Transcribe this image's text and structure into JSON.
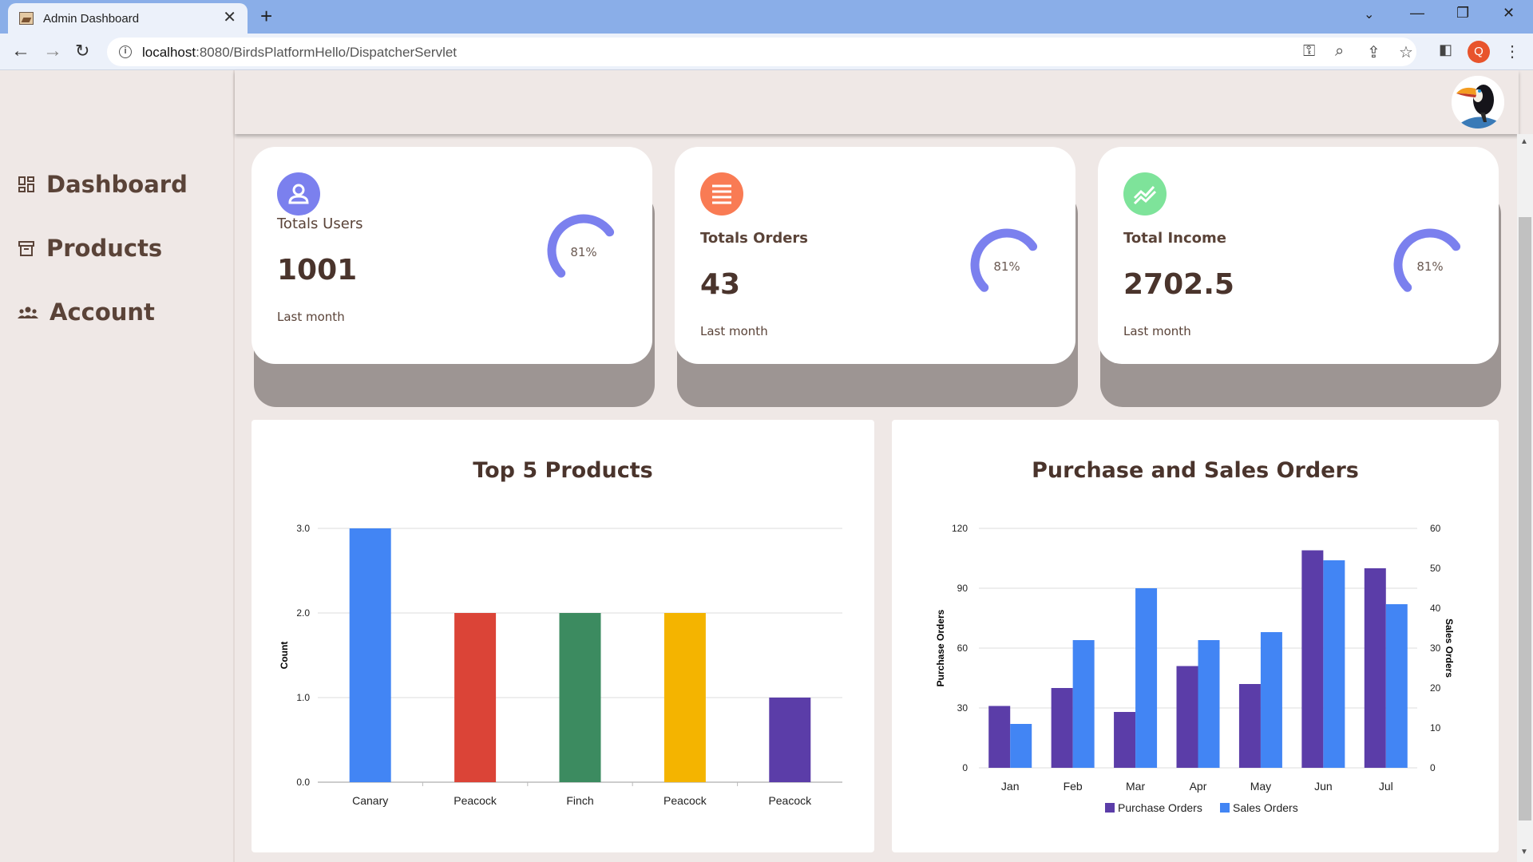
{
  "browser": {
    "tab_title": "Admin Dashboard",
    "url_host": "localhost",
    "url_rest": ":8080/BirdsPlatformHello/DispatcherServlet",
    "profile_initial": "Q"
  },
  "sidebar": {
    "items": [
      {
        "label": "Dashboard",
        "icon": "dashboard-icon"
      },
      {
        "label": "Products",
        "icon": "archive-box-icon"
      },
      {
        "label": "Account",
        "icon": "people-icon"
      }
    ]
  },
  "cards": [
    {
      "label": "Totals Users",
      "value": "1001",
      "period": "Last month",
      "percent": "81%",
      "percent_value": 0.81,
      "icon": "user-icon",
      "icon_color": "#7b80ee"
    },
    {
      "label": "Totals Orders",
      "value": "43",
      "period": "Last month",
      "percent": "81%",
      "percent_value": 0.81,
      "icon": "list-icon",
      "icon_color": "#f97b54"
    },
    {
      "label": "Total Income",
      "value": "2702.5",
      "period": "Last month",
      "percent": "81%",
      "percent_value": 0.81,
      "icon": "trend-chart-icon",
      "icon_color": "#7ee39a"
    }
  ],
  "chart_data": [
    {
      "type": "bar",
      "title": "Top 5 Products",
      "categories": [
        "Canary",
        "Peacock",
        "Finch",
        "Peacock",
        "Peacock"
      ],
      "values": [
        3,
        2,
        2,
        2,
        1
      ],
      "colors": [
        "#4285f4",
        "#db4437",
        "#3c8b60",
        "#f4b400",
        "#5b3da8"
      ],
      "ylabel": "Count",
      "ylim": [
        0,
        3
      ],
      "yticks": [
        "0.0",
        "1.0",
        "2.0",
        "3.0"
      ],
      "grid": true
    },
    {
      "type": "bar",
      "title": "Purchase and Sales Orders",
      "categories": [
        "Jan",
        "Feb",
        "Mar",
        "Apr",
        "May",
        "Jun",
        "Jul"
      ],
      "series": [
        {
          "name": "Purchase Orders",
          "values": [
            31,
            40,
            28,
            51,
            42,
            109,
            100
          ],
          "axis": "left",
          "color": "#5b3da8"
        },
        {
          "name": "Sales Orders",
          "values": [
            11,
            32,
            45,
            32,
            34,
            52,
            41
          ],
          "axis": "right",
          "color": "#4285f4"
        }
      ],
      "ylabel_left": "Purchase Orders",
      "ylabel_right": "Sales Orders",
      "ylim_left": [
        0,
        120
      ],
      "ylim_right": [
        0,
        60
      ],
      "yticks_left": [
        "0",
        "30",
        "60",
        "90",
        "120"
      ],
      "yticks_right": [
        "0",
        "10",
        "20",
        "30",
        "40",
        "50",
        "60"
      ],
      "legend": "bottom",
      "grid": true
    }
  ]
}
